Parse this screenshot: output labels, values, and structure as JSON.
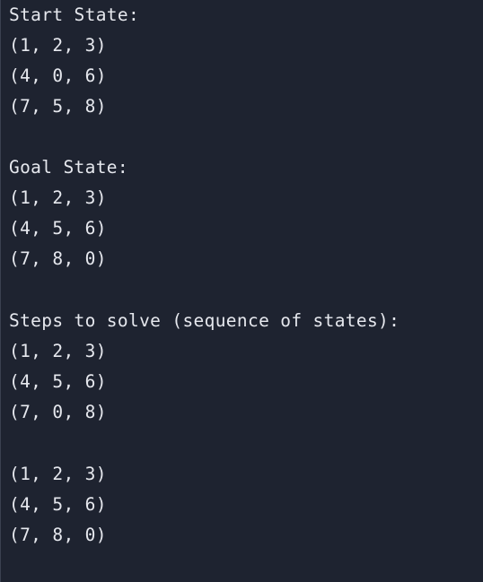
{
  "output": {
    "start_header": "Start State:",
    "start_rows": [
      "(1, 2, 3)",
      "(4, 0, 6)",
      "(7, 5, 8)"
    ],
    "goal_header": "Goal State:",
    "goal_rows": [
      "(1, 2, 3)",
      "(4, 5, 6)",
      "(7, 8, 0)"
    ],
    "steps_header": "Steps to solve (sequence of states):",
    "step1_rows": [
      "(1, 2, 3)",
      "(4, 5, 6)",
      "(7, 0, 8)"
    ],
    "step2_rows": [
      "(1, 2, 3)",
      "(4, 5, 6)",
      "(7, 8, 0)"
    ]
  },
  "colors": {
    "background": "#1e2330",
    "text": "#e6e8ee"
  }
}
